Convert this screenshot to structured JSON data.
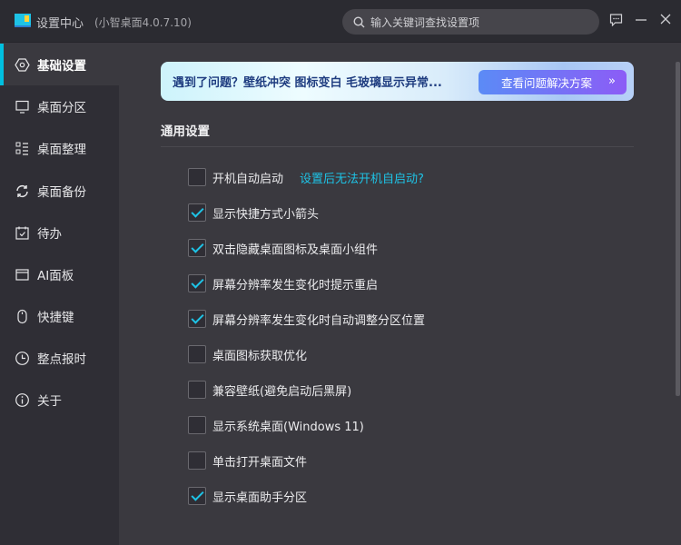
{
  "window": {
    "title": "设置中心",
    "version": "(小智桌面4.0.7.10)"
  },
  "search": {
    "placeholder": "输入关键词查找设置项"
  },
  "sidebar": {
    "items": [
      {
        "label": "基础设置",
        "icon": "settings-hexagon-icon",
        "active": true
      },
      {
        "label": "桌面分区",
        "icon": "monitor-icon"
      },
      {
        "label": "桌面整理",
        "icon": "list-icon"
      },
      {
        "label": "桌面备份",
        "icon": "sync-icon"
      },
      {
        "label": "待办",
        "icon": "calendar-check-icon"
      },
      {
        "label": "AI面板",
        "icon": "window-icon"
      },
      {
        "label": "快捷键",
        "icon": "mouse-icon"
      },
      {
        "label": "整点报时",
        "icon": "clock-icon"
      },
      {
        "label": "关于",
        "icon": "info-icon"
      }
    ]
  },
  "banner": {
    "text": "遇到了问题？壁纸冲突 图标变白 毛玻璃显示异常...",
    "button": "查看问题解决方案",
    "button_icon": "»"
  },
  "section": {
    "title": "通用设置"
  },
  "options": [
    {
      "label": "开机自动启动",
      "checked": false,
      "link": "设置后无法开机自启动?"
    },
    {
      "label": "显示快捷方式小箭头",
      "checked": true
    },
    {
      "label": "双击隐藏桌面图标及桌面小组件",
      "checked": true
    },
    {
      "label": "屏幕分辨率发生变化时提示重启",
      "checked": true
    },
    {
      "label": "屏幕分辨率发生变化时自动调整分区位置",
      "checked": true
    },
    {
      "label": "桌面图标获取优化",
      "checked": false
    },
    {
      "label": "兼容壁纸(避免启动后黑屏)",
      "checked": false
    },
    {
      "label": "显示系统桌面(Windows 11)",
      "checked": false
    },
    {
      "label": "单击打开桌面文件",
      "checked": false
    },
    {
      "label": "显示桌面助手分区",
      "checked": true
    }
  ],
  "colors": {
    "accent": "#1ec3e6",
    "sidebar": "#2f2e35",
    "main": "#3a393f",
    "titlebar": "#2b2b31"
  }
}
